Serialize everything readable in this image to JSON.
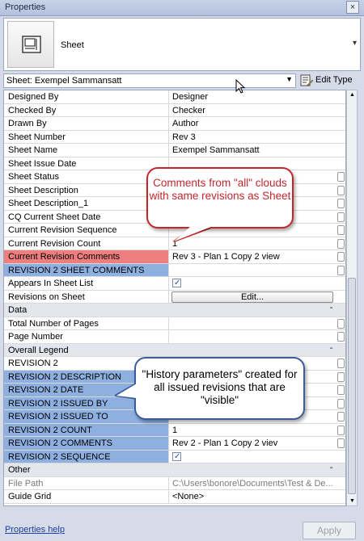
{
  "window": {
    "title": "Properties",
    "close_label": "×"
  },
  "type_selector": {
    "name": "Sheet",
    "chevron": "▾"
  },
  "instance": {
    "selected": "Sheet: Exempel Sammansatt",
    "edit_type_label": "Edit Type"
  },
  "rows": [
    {
      "label": "Designed By",
      "value": "Designer"
    },
    {
      "label": "Checked By",
      "value": "Checker"
    },
    {
      "label": "Drawn By",
      "value": "Author"
    },
    {
      "label": "Sheet Number",
      "value": "Rev 3"
    },
    {
      "label": "Sheet Name",
      "value": "Exempel Sammansatt"
    },
    {
      "label": "Sheet Issue Date",
      "value": ""
    },
    {
      "label": "Sheet Status",
      "value": ""
    },
    {
      "label": "Sheet Description",
      "value": ""
    },
    {
      "label": "Sheet Description_1",
      "value": ""
    },
    {
      "label": "CQ Current Sheet Date",
      "value": ""
    },
    {
      "label": "Current Revision Sequence",
      "value": ""
    },
    {
      "label": "Current Revision Count",
      "value": "1"
    },
    {
      "label": "Current Revision Comments",
      "value": "Rev 3  - Plan 1 Copy 2 view"
    },
    {
      "label": "REVISION 2 SHEET COMMENTS",
      "value": ""
    },
    {
      "label": "Appears In Sheet List",
      "value": ""
    },
    {
      "label": "Revisions on Sheet",
      "value": "Edit..."
    },
    {
      "label": "Data",
      "value": ""
    },
    {
      "label": "Total Number of Pages",
      "value": ""
    },
    {
      "label": "Page Number",
      "value": ""
    },
    {
      "label": "Overall Legend",
      "value": ""
    },
    {
      "label": "REVISION 2",
      "value": ""
    },
    {
      "label": "REVISION 2 DESCRIPTION",
      "value": ""
    },
    {
      "label": "REVISION 2 DATE",
      "value": ""
    },
    {
      "label": "REVISION 2 ISSUED BY",
      "value": ""
    },
    {
      "label": "REVISION 2 ISSUED TO",
      "value": ""
    },
    {
      "label": "REVISION 2 COUNT",
      "value": "1"
    },
    {
      "label": "REVISION 2 COMMENTS",
      "value": "Rev 2 - Plan 1 Copy 2 viev"
    },
    {
      "label": "REVISION 2 SEQUENCE",
      "value": ""
    },
    {
      "label": "Other",
      "value": ""
    },
    {
      "label": "File Path",
      "value": "C:\\Users\\bonore\\Documents\\Test & De..."
    },
    {
      "label": "Guide Grid",
      "value": "<None>"
    }
  ],
  "callouts": {
    "comments": "Comments from \"all\" clouds with same revisions as Sheet",
    "history": "\"History parameters\" created for all issued revisions that are \"visible\""
  },
  "footer": {
    "help_link": "Properties help",
    "apply_label": "Apply"
  },
  "colors": {
    "highlight_red": "#ef7e7e",
    "highlight_blue": "#8eb0e0",
    "callout_red": "#c0282d",
    "callout_blue": "#3b5c9c"
  }
}
